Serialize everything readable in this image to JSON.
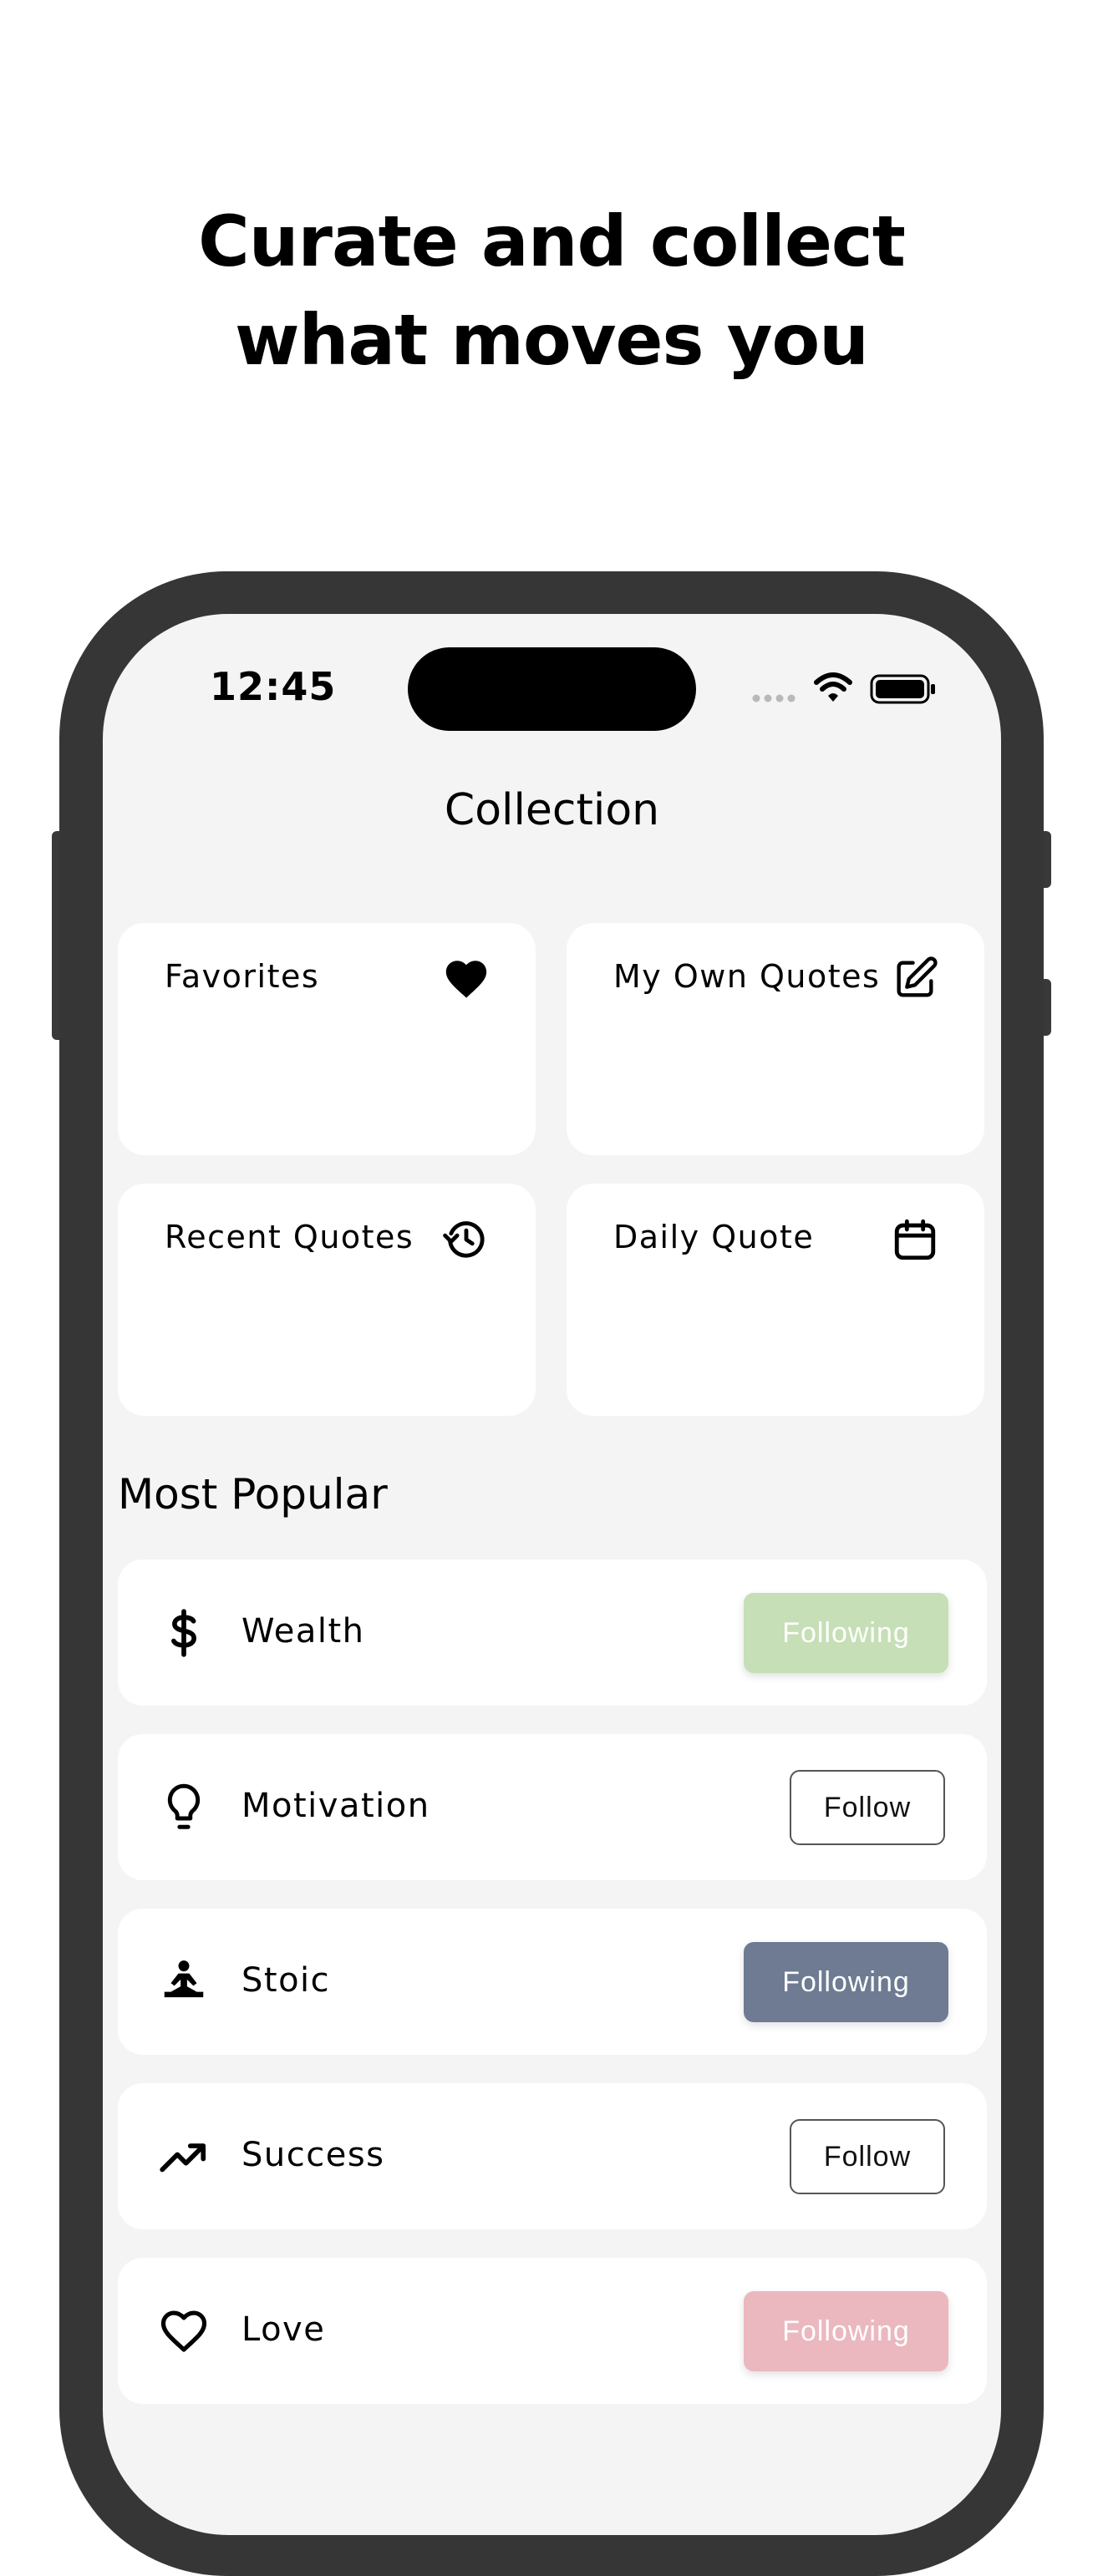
{
  "headline": {
    "line1": "Curate and collect",
    "line2": "what moves you"
  },
  "status_bar": {
    "time": "12:45"
  },
  "screen_title": "Collection",
  "cards": [
    {
      "label": "Favorites",
      "icon": "heart-filled-icon"
    },
    {
      "label": "My Own Quotes",
      "icon": "edit-icon"
    },
    {
      "label": "Recent Quotes",
      "icon": "history-icon"
    },
    {
      "label": "Daily Quote",
      "icon": "calendar-icon"
    }
  ],
  "most_popular": {
    "title": "Most Popular",
    "items": [
      {
        "label": "Wealth",
        "icon": "dollar-icon",
        "button": "Following",
        "button_color": "#c6dfb6"
      },
      {
        "label": "Motivation",
        "icon": "lightbulb-icon",
        "button": "Follow"
      },
      {
        "label": "Stoic",
        "icon": "meditation-icon",
        "button": "Following",
        "button_color": "#6e7b92"
      },
      {
        "label": "Success",
        "icon": "trending-up-icon",
        "button": "Follow"
      },
      {
        "label": "Love",
        "icon": "heart-outline-icon",
        "button": "Following",
        "button_color": "#ebb8c0"
      }
    ]
  },
  "colors": {
    "page_background": "#ffffff",
    "phone_frame": "#373636",
    "screen_background": "#f4f4f4",
    "card_background": "#ffffff"
  }
}
